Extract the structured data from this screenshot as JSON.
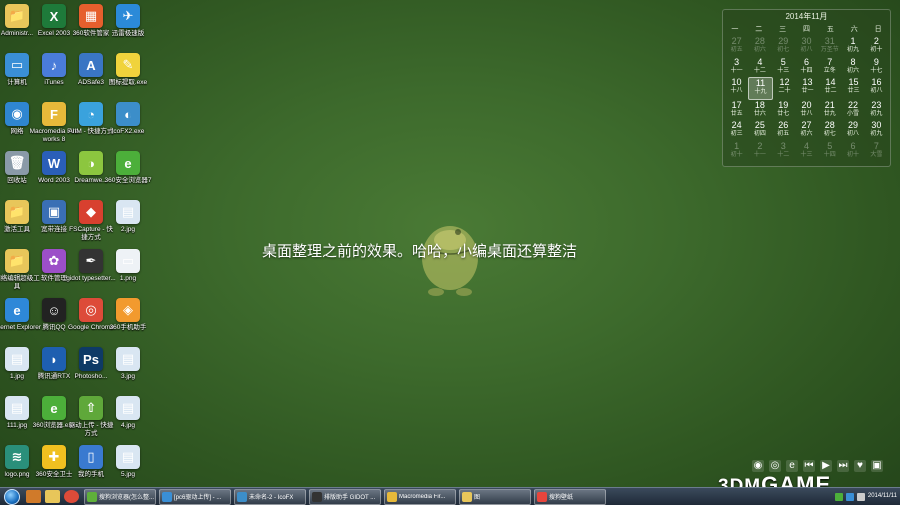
{
  "desktop_icons": [
    {
      "label": "Administr...",
      "color": "#e8c65a",
      "glyph": "📁"
    },
    {
      "label": "Excel 2003",
      "color": "#1e7a3a",
      "glyph": "X"
    },
    {
      "label": "360软件管家",
      "color": "#e65f2d",
      "glyph": "▦"
    },
    {
      "label": "迅雷极速版",
      "color": "#2b8ad8",
      "glyph": "✈"
    },
    {
      "label": "计算机",
      "color": "#3a8fd6",
      "glyph": "▭"
    },
    {
      "label": "iTunes",
      "color": "#4a7cd9",
      "glyph": "♪"
    },
    {
      "label": "ADSafe3",
      "color": "#3a76c4",
      "glyph": "A"
    },
    {
      "label": "图标提取.exe",
      "color": "#f0d33c",
      "glyph": "✎"
    },
    {
      "label": "网络",
      "color": "#2f86d0",
      "glyph": "◉"
    },
    {
      "label": "Macromedia Fireworks 8",
      "color": "#e7b93a",
      "glyph": "F"
    },
    {
      "label": "AIIM - 快捷方式",
      "color": "#3aa2dd",
      "glyph": "◔"
    },
    {
      "label": "IcoFX2.exe",
      "color": "#3c8ec9",
      "glyph": "◐"
    },
    {
      "label": "回收站",
      "color": "#8a9aa8",
      "glyph": "🗑"
    },
    {
      "label": "Word 2003",
      "color": "#2a5fb8",
      "glyph": "W"
    },
    {
      "label": "Dreamwe...",
      "color": "#8cc63f",
      "glyph": "◑"
    },
    {
      "label": "360安全浏览器7",
      "color": "#4caf3a",
      "glyph": "e"
    },
    {
      "label": "激活工具",
      "color": "#e8c65a",
      "glyph": "📁"
    },
    {
      "label": "宽带连接",
      "color": "#3a6fb5",
      "glyph": "▣"
    },
    {
      "label": "FSCapture - 快捷方式",
      "color": "#d8402f",
      "glyph": "◆"
    },
    {
      "label": "2.jpg",
      "color": "#d9e6f2",
      "glyph": "▤"
    },
    {
      "label": "网络编辑超级工具",
      "color": "#e8c65a",
      "glyph": "📁"
    },
    {
      "label": "软件管理",
      "color": "#9c4fc8",
      "glyph": "✿"
    },
    {
      "label": "gidot typesetter...",
      "color": "#333333",
      "glyph": "✒"
    },
    {
      "label": "1.png",
      "color": "#eef2f6",
      "glyph": "▭"
    },
    {
      "label": "Internet Explorer",
      "color": "#2e88d8",
      "glyph": "e"
    },
    {
      "label": "腾讯QQ",
      "color": "#222222",
      "glyph": "☺"
    },
    {
      "label": "Google Chrome",
      "color": "#dd4b39",
      "glyph": "◎"
    },
    {
      "label": "360手机助手",
      "color": "#f29a2e",
      "glyph": "◈"
    },
    {
      "label": "1.jpg",
      "color": "#d9e6f2",
      "glyph": "▤"
    },
    {
      "label": "腾讯通RTX",
      "color": "#1e5fb0",
      "glyph": "◗"
    },
    {
      "label": "Photosho...",
      "color": "#0e3a66",
      "glyph": "Ps"
    },
    {
      "label": "3.jpg",
      "color": "#d9e6f2",
      "glyph": "▤"
    },
    {
      "label": "111.jpg",
      "color": "#d9e6f2",
      "glyph": "▤"
    },
    {
      "label": "360浏览器.exe",
      "color": "#4caf3a",
      "glyph": "e"
    },
    {
      "label": "驱动上传 - 快捷方式",
      "color": "#5fa83a",
      "glyph": "⇧"
    },
    {
      "label": "4.jpg",
      "color": "#d9e6f2",
      "glyph": "▤"
    },
    {
      "label": "logo.png",
      "color": "#2a8f7a",
      "glyph": "≋"
    },
    {
      "label": "360安全卫士",
      "color": "#f0c020",
      "glyph": "✚"
    },
    {
      "label": "我的手机",
      "color": "#3a7ad0",
      "glyph": "▯"
    },
    {
      "label": "5.jpg",
      "color": "#d9e6f2",
      "glyph": "▤"
    }
  ],
  "calendar": {
    "title": "2014年11月",
    "weekdays": [
      "一",
      "二",
      "三",
      "四",
      "五",
      "六",
      "日"
    ],
    "weeks": [
      [
        [
          "27",
          "初五",
          1
        ],
        [
          "28",
          "初六",
          1
        ],
        [
          "29",
          "初七",
          1
        ],
        [
          "30",
          "初八",
          1
        ],
        [
          "31",
          "万圣节",
          1
        ],
        [
          "1",
          "初九",
          0
        ],
        [
          "2",
          "初十",
          0
        ]
      ],
      [
        [
          "3",
          "十一",
          0
        ],
        [
          "4",
          "十二",
          0
        ],
        [
          "5",
          "十三",
          0
        ],
        [
          "6",
          "十四",
          0
        ],
        [
          "7",
          "立冬",
          0
        ],
        [
          "8",
          "初六",
          0
        ],
        [
          "9",
          "十七",
          0
        ]
      ],
      [
        [
          "10",
          "十八",
          0
        ],
        [
          "11",
          "十九",
          0
        ],
        [
          "12",
          "二十",
          0
        ],
        [
          "13",
          "廿一",
          0
        ],
        [
          "14",
          "廿二",
          0
        ],
        [
          "15",
          "廿三",
          0
        ],
        [
          "16",
          "初八",
          0
        ]
      ],
      [
        [
          "17",
          "廿五",
          0
        ],
        [
          "18",
          "廿六",
          0
        ],
        [
          "19",
          "廿七",
          0
        ],
        [
          "20",
          "廿八",
          0
        ],
        [
          "21",
          "廿九",
          0
        ],
        [
          "22",
          "小雪",
          0
        ],
        [
          "23",
          "初九",
          0
        ]
      ],
      [
        [
          "24",
          "初三",
          0
        ],
        [
          "25",
          "初四",
          0
        ],
        [
          "26",
          "初五",
          0
        ],
        [
          "27",
          "初六",
          0
        ],
        [
          "28",
          "初七",
          0
        ],
        [
          "29",
          "初八",
          0
        ],
        [
          "30",
          "初九",
          0
        ]
      ],
      [
        [
          "1",
          "初十",
          1
        ],
        [
          "2",
          "十一",
          1
        ],
        [
          "3",
          "十二",
          1
        ],
        [
          "4",
          "十三",
          1
        ],
        [
          "5",
          "十四",
          1
        ],
        [
          "6",
          "初十",
          1
        ],
        [
          "7",
          "大雪",
          1
        ]
      ]
    ],
    "today": "11"
  },
  "center_text": "桌面整理之前的效果。哈哈，小编桌面还算整洁",
  "watermark": {
    "part1": "3DM",
    "part2": "GAME"
  },
  "taskbar": {
    "items": [
      {
        "label": "搜狗浏览器(怎么整...",
        "color": "#5fb03a"
      },
      {
        "label": "[pc6驱动上传] - ...",
        "color": "#3a8fd6"
      },
      {
        "label": "未命名-2 - IcoFX",
        "color": "#3c8ec9"
      },
      {
        "label": "排版助手 GIDOT ...",
        "color": "#333333"
      },
      {
        "label": "Macromedia Fir...",
        "color": "#e7b93a"
      },
      {
        "label": "图",
        "color": "#e8c65a"
      },
      {
        "label": "搜狗壁纸",
        "color": "#e8453c"
      }
    ],
    "clock": {
      "date": "2014/11/11"
    }
  },
  "colors": {
    "accent": "#3d6a2c",
    "taskbar": "#2a3646"
  }
}
